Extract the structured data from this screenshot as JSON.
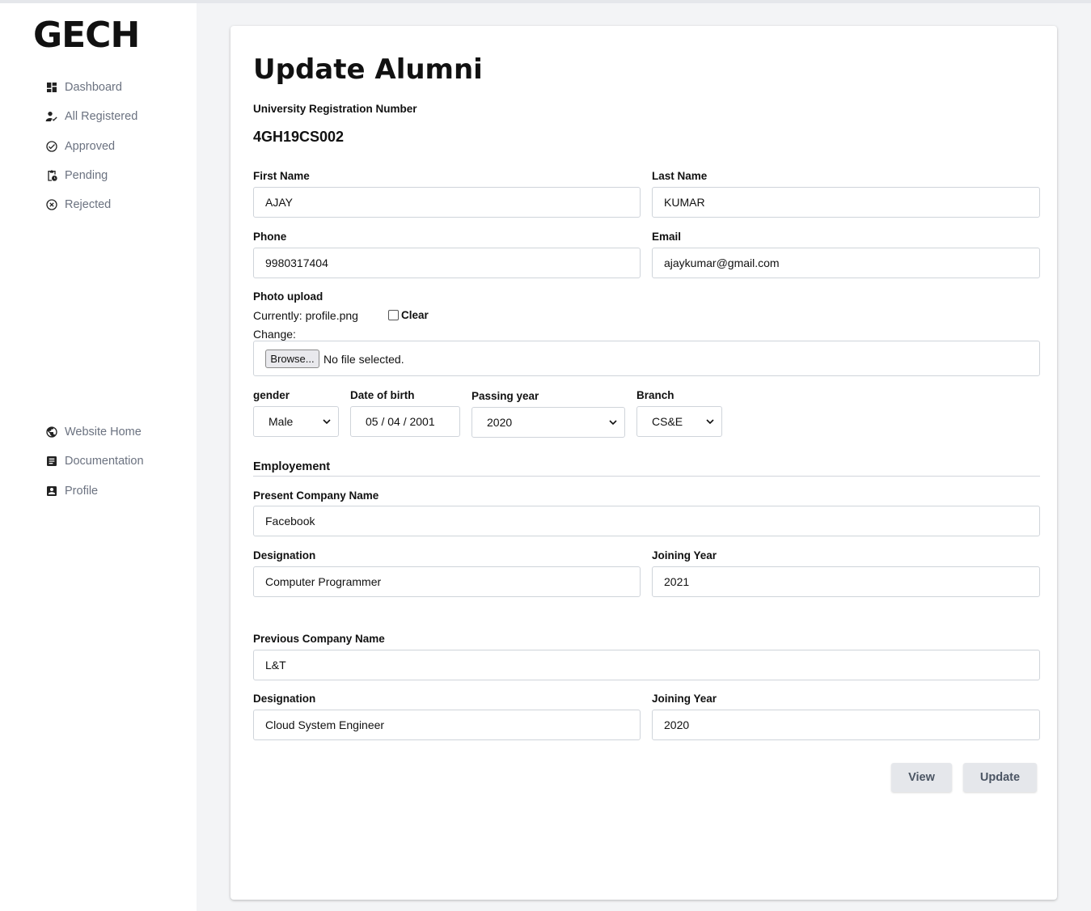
{
  "sidebar": {
    "logo": "GECH",
    "nav_top": [
      {
        "label": "Dashboard",
        "icon": "dashboard-icon"
      },
      {
        "label": "All Registered",
        "icon": "user-check-icon"
      },
      {
        "label": "Approved",
        "icon": "check-circle-icon"
      },
      {
        "label": "Pending",
        "icon": "clipboard-clock-icon"
      },
      {
        "label": "Rejected",
        "icon": "x-circle-icon"
      }
    ],
    "nav_bottom": [
      {
        "label": "Website Home",
        "icon": "globe-icon"
      },
      {
        "label": "Documentation",
        "icon": "document-icon"
      },
      {
        "label": "Profile",
        "icon": "profile-card-icon"
      }
    ]
  },
  "form": {
    "title": "Update Alumni",
    "reg_label": "University Registration Number",
    "reg_value": "4GH19CS002",
    "first_name_label": "First Name",
    "first_name": "AJAY",
    "last_name_label": "Last Name",
    "last_name": "KUMAR",
    "phone_label": "Phone",
    "phone": "9980317404",
    "email_label": "Email",
    "email": "ajaykumar@gmail.com",
    "photo_label": "Photo upload",
    "currently_text": "Currently: profile.png",
    "clear_label": "Clear",
    "change_label": "Change:",
    "browse_label": "Browse...",
    "no_file_text": "No file selected.",
    "gender_label": "gender",
    "gender": "Male",
    "dob_label": "Date of birth",
    "dob": "05 / 04 / 2001",
    "passing_label": "Passing year",
    "passing_year": "2020",
    "branch_label": "Branch",
    "branch": "CS&E"
  },
  "employment": {
    "section_label": "Employement",
    "present_company_label": "Present Company Name",
    "present_company": "Facebook",
    "present_designation_label": "Designation",
    "present_designation": "Computer Programmer",
    "present_joining_label": "Joining Year",
    "present_joining": "2021",
    "previous_company_label": "Previous Company Name",
    "previous_company": "L&T",
    "previous_designation_label": "Designation",
    "previous_designation": "Cloud System Engineer",
    "previous_joining_label": "Joining Year",
    "previous_joining": "2020"
  },
  "actions": {
    "view_label": "View",
    "update_label": "Update"
  }
}
